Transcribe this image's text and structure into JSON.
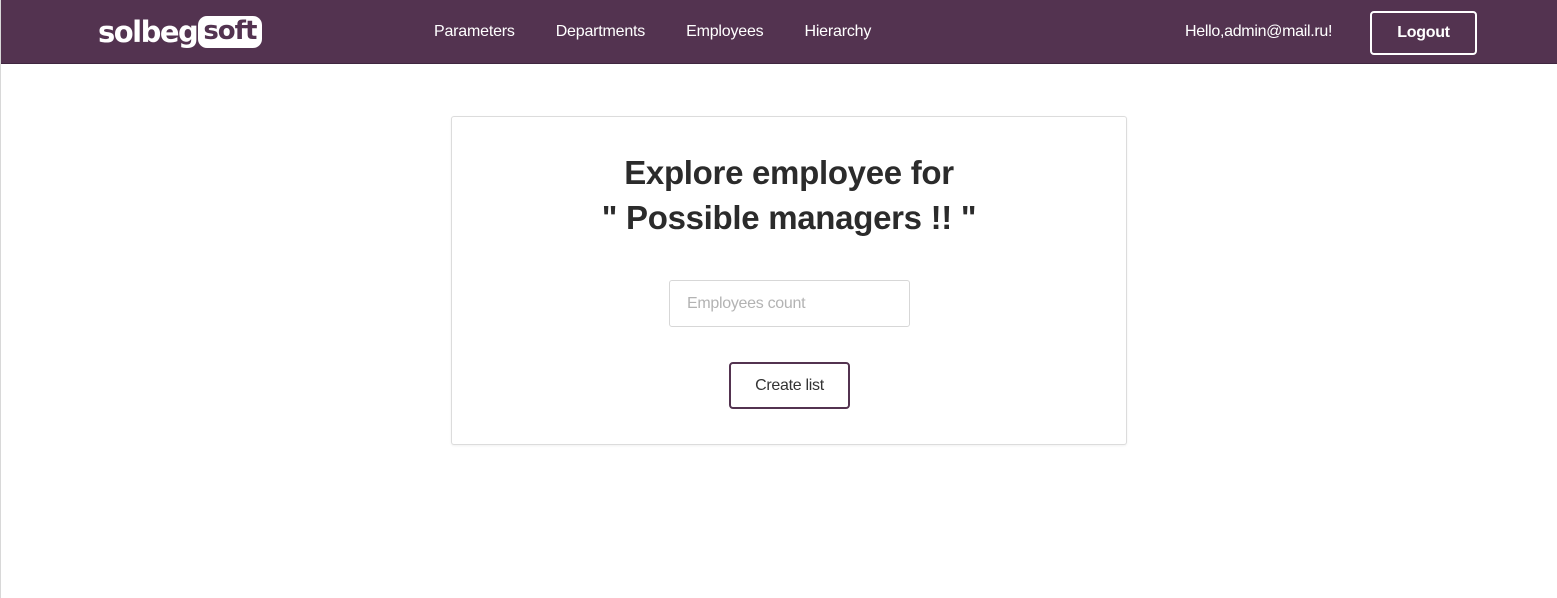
{
  "header": {
    "logo": {
      "part1": "solbeg",
      "part2": "soft"
    },
    "nav": [
      {
        "label": "Parameters"
      },
      {
        "label": "Departments"
      },
      {
        "label": "Employees"
      },
      {
        "label": "Hierarchy"
      }
    ],
    "greeting": "Hello,admin@mail.ru!",
    "logout_label": "Logout",
    "background_color": "#533350"
  },
  "main": {
    "title_line1": "Explore employee for",
    "title_line2": "\" Possible managers !! \"",
    "count_input": {
      "value": "",
      "placeholder": "Employees count"
    },
    "create_button_label": "Create list",
    "accent_color": "#533350"
  }
}
